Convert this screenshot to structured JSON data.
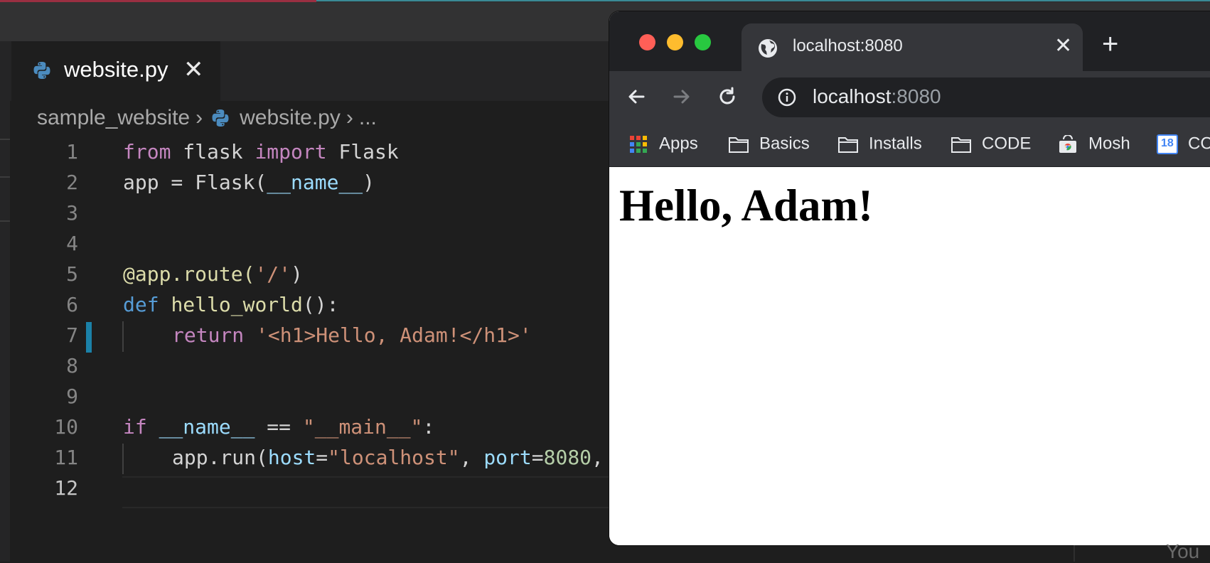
{
  "editor": {
    "tab": {
      "filename": "website.py",
      "close_glyph": "✕"
    },
    "breadcrumb": {
      "folder": "sample_website",
      "separator": "›",
      "file": "website.py",
      "more": "..."
    },
    "colors": {
      "keyword": "#c586c0",
      "function": "#dcdcaa",
      "string": "#ce9178",
      "variable": "#9cdcfe",
      "def": "#569cd6",
      "number": "#b5cea8",
      "modified_marker": "#1b81a8"
    },
    "lines": [
      {
        "n": "1",
        "t": {
          "kw1": "from",
          "a": " flask ",
          "kw2": "import",
          "b": " Flask"
        }
      },
      {
        "n": "2",
        "t": {
          "a": "app = Flask(",
          "var": "__name__",
          "b": ")"
        }
      },
      {
        "n": "3"
      },
      {
        "n": "4"
      },
      {
        "n": "5",
        "t": {
          "fn": "@app.route(",
          "str": "'/'",
          "b": ")"
        }
      },
      {
        "n": "6",
        "t": {
          "def": "def",
          "sp": " ",
          "fn": "hello_world",
          "b": "():"
        }
      },
      {
        "n": "7",
        "t": {
          "kw": "return",
          "sp": " ",
          "str": "'<h1>Hello, Adam!</h1>'"
        }
      },
      {
        "n": "8"
      },
      {
        "n": "9"
      },
      {
        "n": "10",
        "t": {
          "kw": "if",
          "sp": " ",
          "var": "__name__",
          "b": " == ",
          "str": "\"__main__\"",
          "c": ":"
        }
      },
      {
        "n": "11",
        "t": {
          "a": "app.run(",
          "var1": "host",
          "eq1": "=",
          "str": "\"localhost\"",
          "comma": ", ",
          "var2": "port",
          "eq2": "=",
          "num": "8080",
          "end": ","
        }
      },
      {
        "n": "12"
      }
    ]
  },
  "browser": {
    "tab_title": "localhost:8080",
    "tab_close": "✕",
    "new_tab": "+",
    "url_host": "localhost",
    "url_port": ":8080",
    "bookmarks": [
      "Apps",
      "Basics",
      "Installs",
      "CODE",
      "Mosh",
      "CC"
    ],
    "calendar_day": "18",
    "page_heading": "Hello, Adam!",
    "colors": {
      "close": "#ff5f57",
      "minimize": "#febc2e",
      "maximize": "#28c840"
    }
  },
  "background_text": "You"
}
